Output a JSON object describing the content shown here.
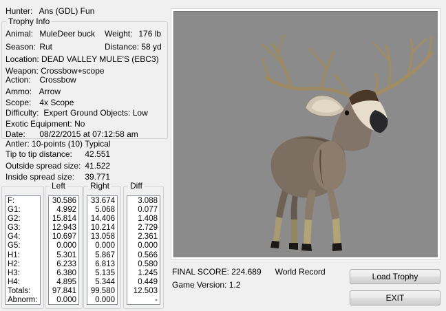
{
  "hunter": {
    "label": "Hunter:",
    "value": "Ans (GDL) Fun"
  },
  "trophy_info": {
    "title": "Trophy Info",
    "animal": {
      "label": "Animal:",
      "value": "MuleDeer buck"
    },
    "weight": {
      "label": "Weight:",
      "value": "176 lb"
    },
    "season": {
      "label": "Season:",
      "value": "Rut"
    },
    "distance": {
      "label": "Distance:",
      "value": "58 yd"
    },
    "location": {
      "label": "Location:",
      "value": "DEAD VALLEY MULE'S (EBC3)"
    },
    "weapon": {
      "label": "Weapon:",
      "value": "Crossbow+scope"
    },
    "action": {
      "label": "Action:",
      "value": "Crossbow"
    },
    "ammo": {
      "label": "Ammo:",
      "value": "Arrow"
    },
    "scope": {
      "label": "Scope:",
      "value": "4x Scope"
    },
    "difficulty": {
      "label": "Difficulty:",
      "value": "Expert"
    },
    "ground_objects": {
      "label": "Ground Objects:",
      "value": "Low"
    },
    "exotic_equipment": {
      "label": "Exotic Equipment:",
      "value": "No"
    },
    "date": {
      "label": "Date:",
      "value": "08/22/2015 at 07:12:58 am"
    }
  },
  "antler": {
    "summary": "Antler: 10-points (10) Typical",
    "tip_to_tip": {
      "label": "Tip to tip distance:",
      "value": "42.551"
    },
    "outside_spread": {
      "label": "Outside spread size:",
      "value": "41.522"
    },
    "inside_spread": {
      "label": "Inside spread size:",
      "value": "39.771"
    }
  },
  "measure_table": {
    "columns": {
      "left": "Left",
      "right": "Right",
      "diff": "Diff"
    },
    "rows": [
      {
        "label": "F:",
        "left": "30.586",
        "right": "33.674",
        "diff": "3.088"
      },
      {
        "label": "G1:",
        "left": "4.992",
        "right": "5.068",
        "diff": "0.077"
      },
      {
        "label": "G2:",
        "left": "15.814",
        "right": "14.406",
        "diff": "1.408"
      },
      {
        "label": "G3:",
        "left": "12.943",
        "right": "10.214",
        "diff": "2.729"
      },
      {
        "label": "G4:",
        "left": "10.697",
        "right": "13.058",
        "diff": "2.361"
      },
      {
        "label": "G5:",
        "left": "0.000",
        "right": "0.000",
        "diff": "0.000"
      },
      {
        "label": "H1:",
        "left": "5.301",
        "right": "5.867",
        "diff": "0.566"
      },
      {
        "label": "H2:",
        "left": "6.233",
        "right": "6.813",
        "diff": "0.580"
      },
      {
        "label": "H3:",
        "left": "6.380",
        "right": "5.135",
        "diff": "1.245"
      },
      {
        "label": "H4:",
        "left": "4.895",
        "right": "5.344",
        "diff": "0.449"
      },
      {
        "label": "Totals:",
        "left": "97.841",
        "right": "99.580",
        "diff": "12.503"
      },
      {
        "label": "Abnorm:",
        "left": "0.000",
        "right": "0.000",
        "diff": "-"
      }
    ]
  },
  "viewport": {
    "subject": "mule-deer-buck-3d-render",
    "bg": "#8B8B8B"
  },
  "footer": {
    "final_score": {
      "label": "FINAL SCORE:",
      "value": "224.689",
      "badge": "World Record"
    },
    "game_version": {
      "label": "Game Version:",
      "value": "1.2"
    },
    "load_trophy_label": "Load Trophy",
    "exit_label": "EXIT"
  },
  "colors": {
    "dialog_bg": "#F0F0F0",
    "viewport_bg": "#8B8B8B",
    "groupbox_border": "#CFCFCF",
    "listbox_border": "#8A9097",
    "button_border": "#ACACAC"
  }
}
